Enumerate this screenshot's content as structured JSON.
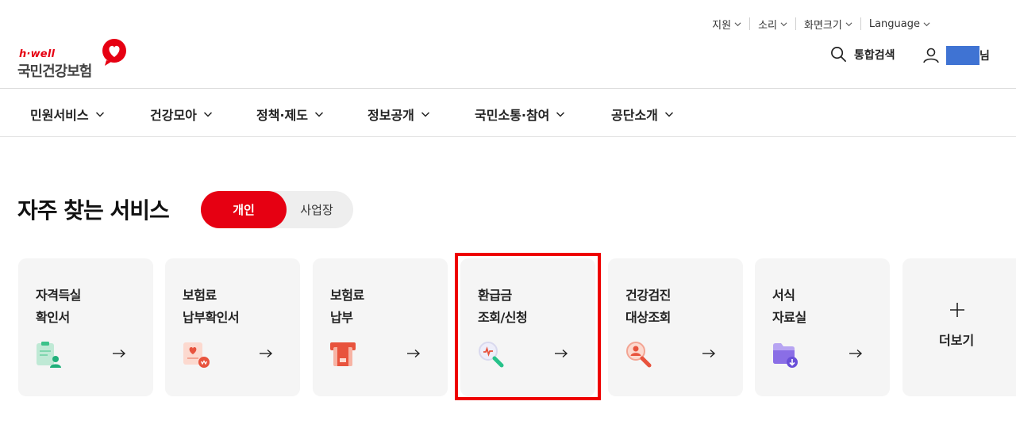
{
  "utility_menu": {
    "items": [
      {
        "label": "지원"
      },
      {
        "label": "소리"
      },
      {
        "label": "화면크기"
      },
      {
        "label": "Language"
      }
    ]
  },
  "logo": {
    "small_text": "h·well",
    "main_text": "국민건강보험"
  },
  "header": {
    "search_label": "통합검색",
    "user_suffix": "님"
  },
  "gnb": {
    "items": [
      {
        "label": "민원서비스"
      },
      {
        "label": "건강모아"
      },
      {
        "label": "정책·제도"
      },
      {
        "label": "정보공개"
      },
      {
        "label": "국민소통·참여"
      },
      {
        "label": "공단소개"
      }
    ]
  },
  "services": {
    "title": "자주 찾는 서비스",
    "toggle": {
      "active": "개인",
      "inactive": "사업장"
    },
    "cards": [
      {
        "line1": "자격득실",
        "line2": "확인서",
        "icon": "id-card-person-icon",
        "arrow": "→"
      },
      {
        "line1": "보험료",
        "line2": "납부확인서",
        "icon": "certificate-heart-icon",
        "arrow": "→"
      },
      {
        "line1": "보험료",
        "line2": "납부",
        "icon": "payment-card-icon",
        "arrow": "→"
      },
      {
        "line1": "환급금",
        "line2": "조회/신청",
        "icon": "refund-search-icon",
        "arrow": "→"
      },
      {
        "line1": "건강검진",
        "line2": "대상조회",
        "icon": "person-search-icon",
        "arrow": "→"
      },
      {
        "line1": "서식",
        "line2": "자료실",
        "icon": "folder-download-icon",
        "arrow": "→"
      }
    ],
    "more": {
      "label": "더보기",
      "icon": "plus-icon"
    }
  },
  "colors": {
    "brand_red": "#e60012",
    "highlight": "#ee0000",
    "card_bg": "#f5f5f5",
    "user_mask": "#3f73d3"
  }
}
